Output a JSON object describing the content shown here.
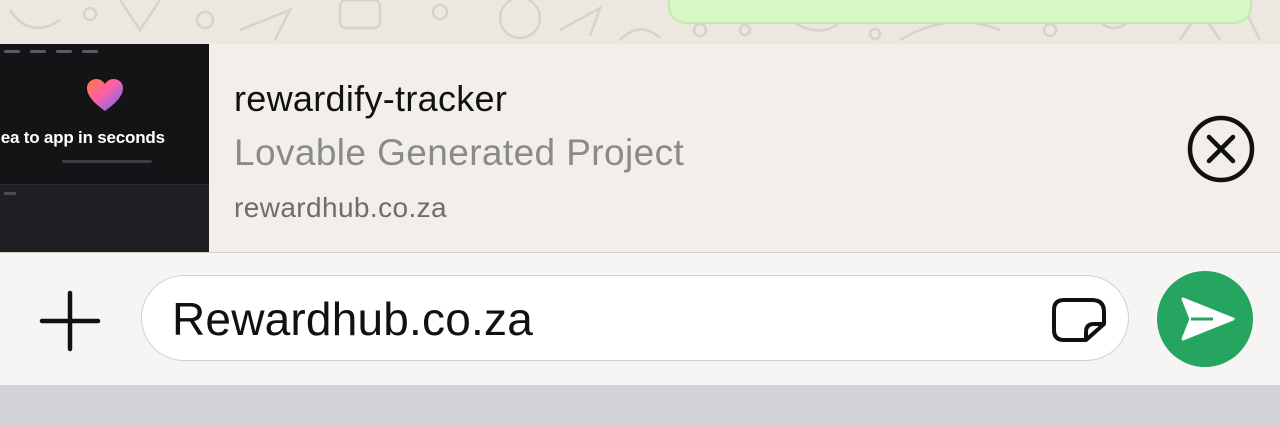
{
  "theme": {
    "accent": "#25A560",
    "bubble": "#D7F8C4",
    "thumbnail_bg": "#141417"
  },
  "link_preview": {
    "thumbnail": {
      "headline": "idea to app in seconds",
      "icon": "heart-logo-icon"
    },
    "title": "rewardify-tracker",
    "description": "Lovable Generated Project",
    "domain": "rewardhub.co.za",
    "close_icon": "close-circle-icon"
  },
  "composer": {
    "attach_icon": "plus-icon",
    "message_value": "Rewardhub.co.za",
    "sticker_icon": "sticker-icon",
    "send_icon": "send-icon"
  }
}
